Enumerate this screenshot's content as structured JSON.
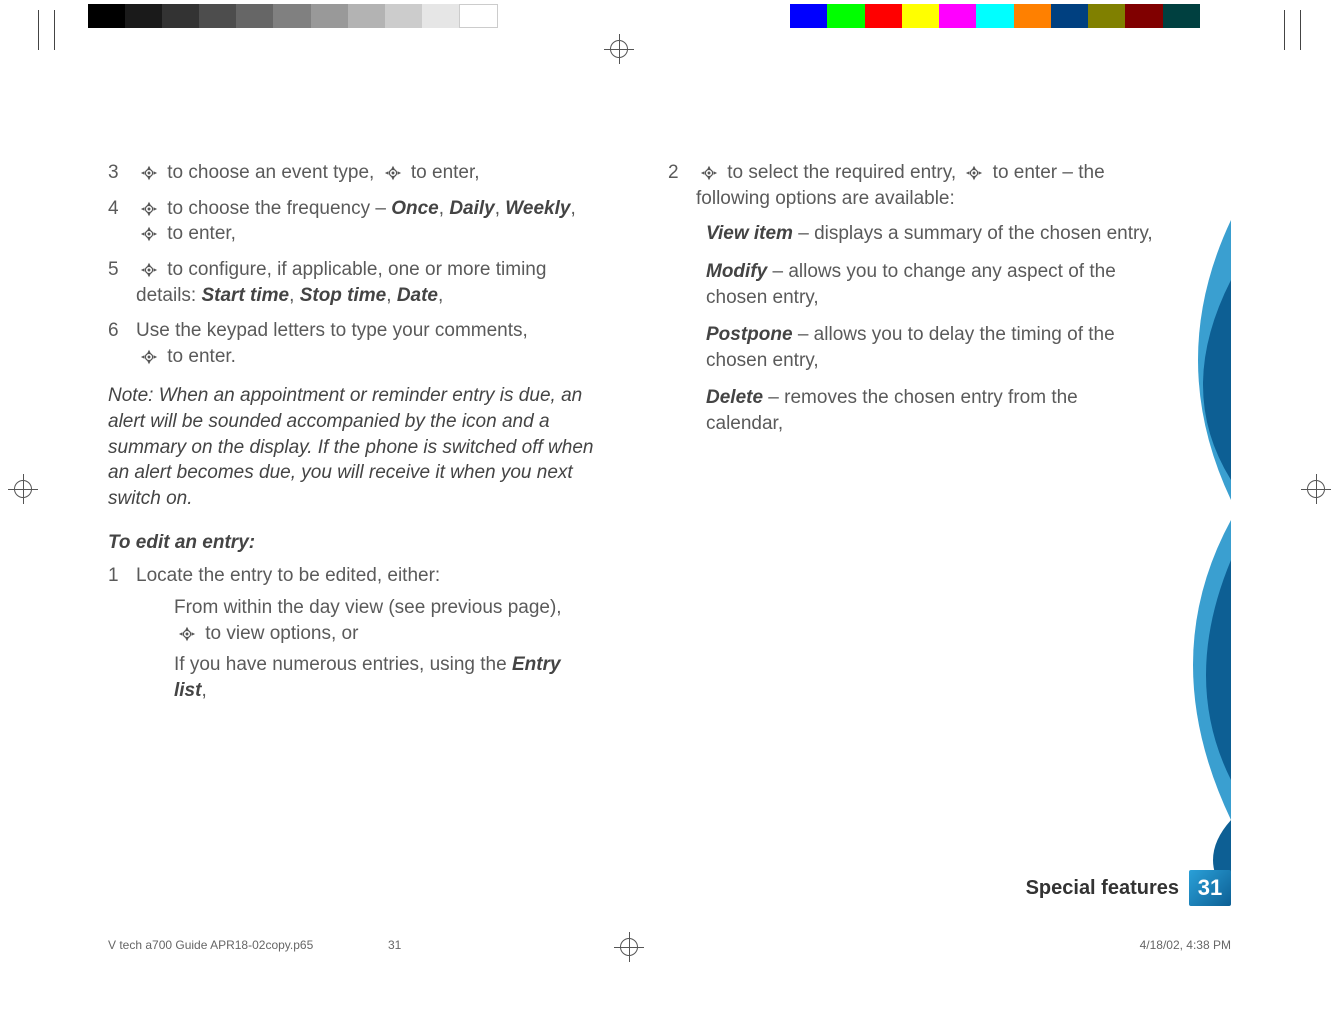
{
  "left": {
    "items": [
      {
        "n": "3",
        "pre": " to choose an event type, ",
        "post": " to enter,"
      },
      {
        "n": "4",
        "pre": " to choose the frequency – ",
        "opts": [
          "Once",
          "Daily",
          "Weekly"
        ],
        "post2": " to enter,"
      },
      {
        "n": "5",
        "pre": " to configure, if applicable, one or more timing details: ",
        "opts": [
          "Start time",
          "Stop time",
          "Date"
        ],
        "tail": ","
      },
      {
        "n": "6",
        "text": "Use the keypad letters to type your comments, ",
        "post": " to enter."
      }
    ],
    "note": "Note: When an appointment or reminder entry is due, an alert will be sounded accompanied by the icon and a summary on the display. If the phone is switched off when an alert becomes due, you will receive it when you next switch on.",
    "subhead": "To edit an entry:",
    "edit": {
      "n": "1",
      "text": "Locate the entry to be edited, either:",
      "sub1a": "From within the day view (see previous page), ",
      "sub1b": " to view options, or",
      "sub2a": "If you have numerous entries, using the ",
      "sub2b": "Entry list",
      "sub2c": ","
    }
  },
  "right": {
    "item": {
      "n": "2",
      "pre": " to select the required entry, ",
      "mid": " to enter – the following options are available:"
    },
    "options": [
      {
        "h": "View item",
        "t": " – displays a summary of the chosen entry,"
      },
      {
        "h": "Modify",
        "t": " – allows you to change any aspect of the chosen entry,"
      },
      {
        "h": "Postpone",
        "t": " – allows you to delay the timing of the chosen entry,"
      },
      {
        "h": "Delete",
        "t": " – removes the chosen entry from the calendar,"
      }
    ]
  },
  "footer": {
    "label": "Special features",
    "page": "31"
  },
  "meta": {
    "file": "V tech a700 Guide APR18-02copy.p65",
    "page": "31",
    "datetime": "4/18/02, 4:38 PM"
  },
  "colors": {
    "gray": [
      "#000000",
      "#1a1a1a",
      "#333333",
      "#4d4d4d",
      "#666666",
      "#808080",
      "#999999",
      "#b3b3b3",
      "#cccccc",
      "#e6e6e6",
      "#ffffff"
    ],
    "color": [
      "#0000ff",
      "#00ff00",
      "#ff0000",
      "#ffff00",
      "#ff00ff",
      "#00ffff",
      "#ff8000",
      "#004080",
      "#808000",
      "#800000",
      "#004040"
    ]
  }
}
